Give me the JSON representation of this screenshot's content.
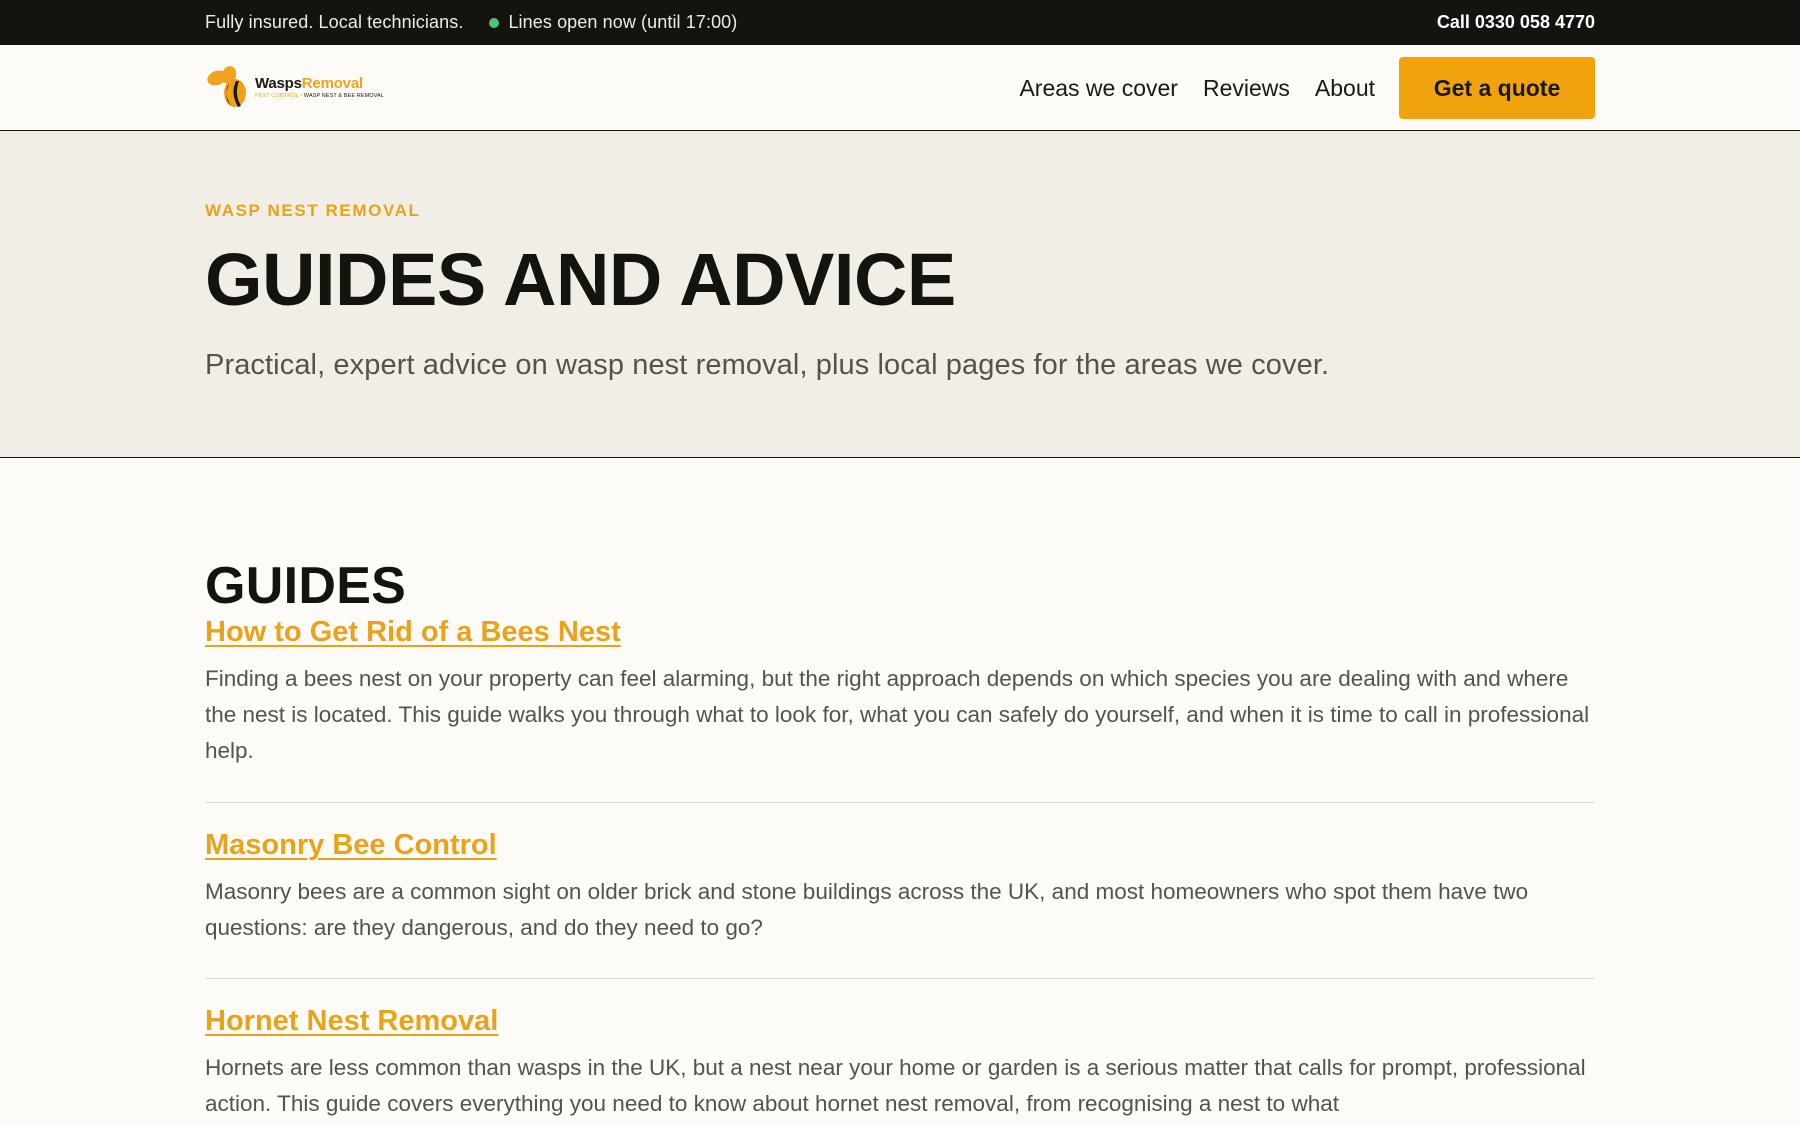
{
  "topbar": {
    "insured_text": "Fully insured. Local technicians.",
    "status_text": "Lines open now (until 17:00)",
    "status_color": "#4ec27a",
    "call_text": "Call 0330 058 4770"
  },
  "header": {
    "logo": {
      "name_part1": "Wasps",
      "name_part2": "Removal",
      "tag_part1": "PEST CONTROL",
      "tag_part2": " · WASP NEST & BEE REMOVAL"
    },
    "nav": {
      "areas": "Areas we cover",
      "reviews": "Reviews",
      "about": "About",
      "quote": "Get a quote"
    }
  },
  "hero": {
    "eyebrow": "WASP NEST REMOVAL",
    "title": "GUIDES AND ADVICE",
    "subtitle": "Practical, expert advice on wasp nest removal, plus local pages for the areas we cover."
  },
  "guides": {
    "heading": "GUIDES",
    "items": [
      {
        "title": "How to Get Rid of a Bees Nest",
        "description": "Finding a bees nest on your property can feel alarming, but the right approach depends on which species you are dealing with and where the nest is located. This guide walks you through what to look for, what you can safely do yourself, and when it is time to call in professional help."
      },
      {
        "title": "Masonry Bee Control",
        "description": "Masonry bees are a common sight on older brick and stone buildings across the UK, and most homeowners who spot them have two questions: are they dangerous, and do they need to go?"
      },
      {
        "title": "Hornet Nest Removal",
        "description": "Hornets are less common than wasps in the UK, but a nest near your home or garden is a serious matter that calls for prompt, professional action. This guide covers everything you need to know about hornet nest removal, from recognising a nest to what"
      }
    ]
  },
  "colors": {
    "accent": "#f0a30c",
    "link": "#e8a21b",
    "dark": "#141310",
    "hero_bg": "#f1eee6",
    "page_bg": "#fcfbf7"
  }
}
